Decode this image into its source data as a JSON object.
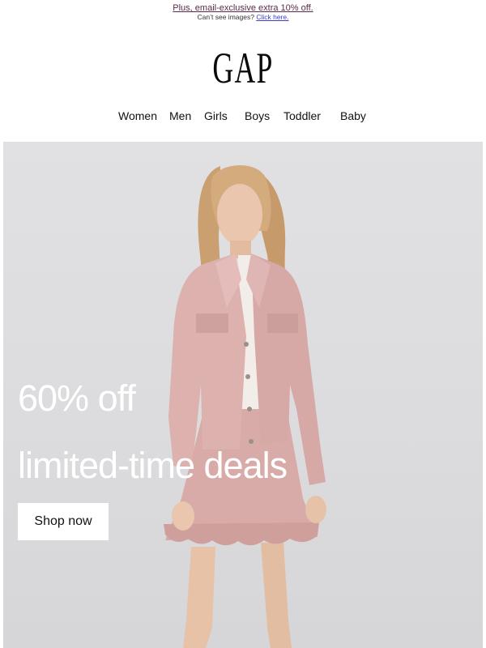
{
  "preheader": {
    "promo_text": "Plus, email-exclusive extra 10% off.",
    "images_prefix": "Can’t see images?",
    "images_link": "Click here."
  },
  "brand": {
    "logo": "GAP"
  },
  "nav": {
    "items": [
      {
        "label": "Women"
      },
      {
        "label": "Men"
      },
      {
        "label": "Girls"
      },
      {
        "label": "Boys"
      },
      {
        "label": "Toddler"
      },
      {
        "label": "Baby"
      }
    ]
  },
  "hero": {
    "headline_1": "60% off",
    "headline_2": "limited-time deals",
    "cta_label": "Shop now",
    "background_color": "#dedee0",
    "outfit_color": "#d8aaa8"
  }
}
